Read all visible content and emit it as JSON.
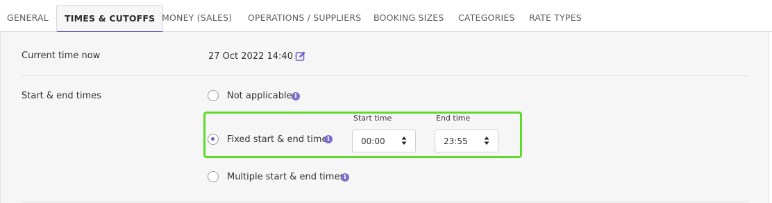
{
  "tabs": [
    {
      "label": "GENERAL",
      "active": false
    },
    {
      "label": "TIMES & CUTOFFS",
      "active": true
    },
    {
      "label": "MONEY (SALES)",
      "active": false
    },
    {
      "label": "OPERATIONS / SUPPLIERS",
      "active": false
    },
    {
      "label": "BOOKING SIZES",
      "active": false
    },
    {
      "label": "CATEGORIES",
      "active": false
    },
    {
      "label": "RATE TYPES",
      "active": false
    }
  ],
  "current_time": {
    "label": "Current time now",
    "value": "27 Oct 2022 14:40",
    "edit_icon": "edit-icon"
  },
  "start_end": {
    "label": "Start & end times",
    "options": [
      {
        "label": "Not applicable",
        "selected": false
      },
      {
        "label": "Fixed start & end time",
        "selected": true
      },
      {
        "label": "Multiple start & end times",
        "selected": false
      }
    ],
    "start_time": {
      "label": "Start time",
      "value": "00:00"
    },
    "end_time": {
      "label": "End time",
      "value": "23:55"
    }
  },
  "colors": {
    "accent": "#6b5fc7",
    "highlight_border": "#5ddb2c",
    "panel_bg": "#f6f6f7"
  }
}
